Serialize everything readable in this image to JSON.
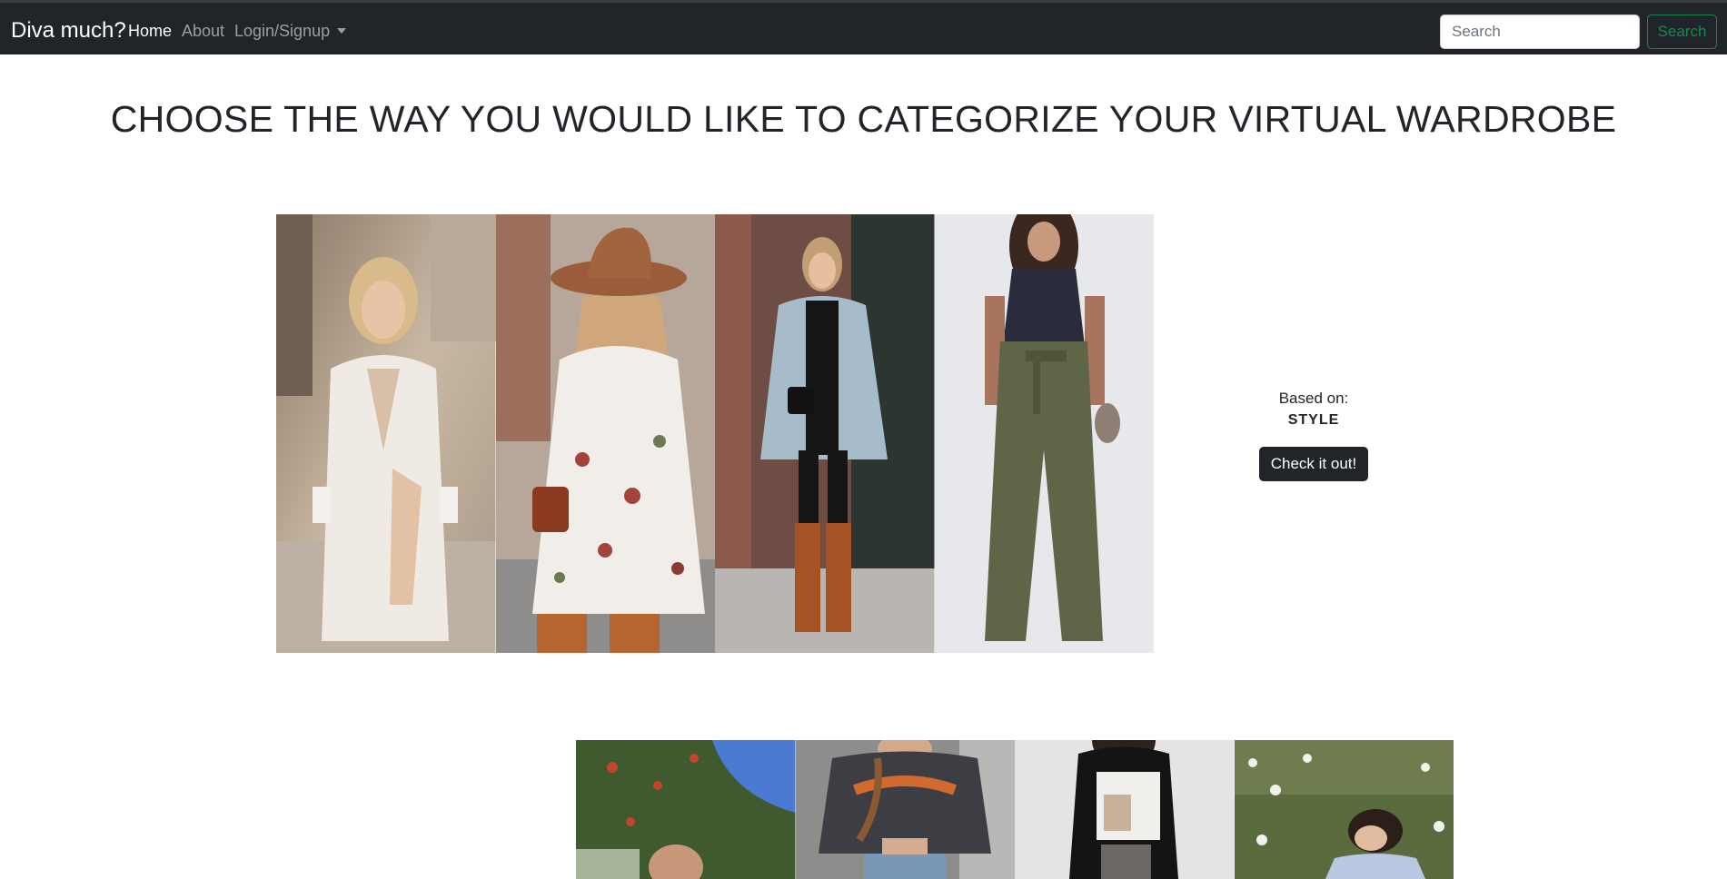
{
  "navbar": {
    "brand": "Diva much?",
    "links": [
      {
        "label": "Home",
        "active": true
      },
      {
        "label": "About",
        "active": false
      },
      {
        "label": "Login/Signup",
        "active": false,
        "dropdown": true
      }
    ],
    "search": {
      "placeholder": "Search",
      "button_label": "Search"
    }
  },
  "heading": "CHOOSE THE WAY YOU WOULD LIKE TO CATEGORIZE YOUR VIRTUAL WARDROBE",
  "categories": [
    {
      "based_on_label": "Based on:",
      "name": "STYLE",
      "button_label": "Check it out!",
      "photos": [
        "white-gown-photo",
        "floral-dress-hat-photo",
        "coat-boots-photo",
        "olive-trousers-photo"
      ]
    },
    {
      "photos": [
        "outdoor-hedge-photo",
        "michigan-sweatshirt-photo",
        "black-top-book-photo",
        "flower-field-photo"
      ]
    }
  ],
  "colors": {
    "navbar_bg": "#212529",
    "search_accent": "#198754",
    "button_dark": "#212529"
  }
}
